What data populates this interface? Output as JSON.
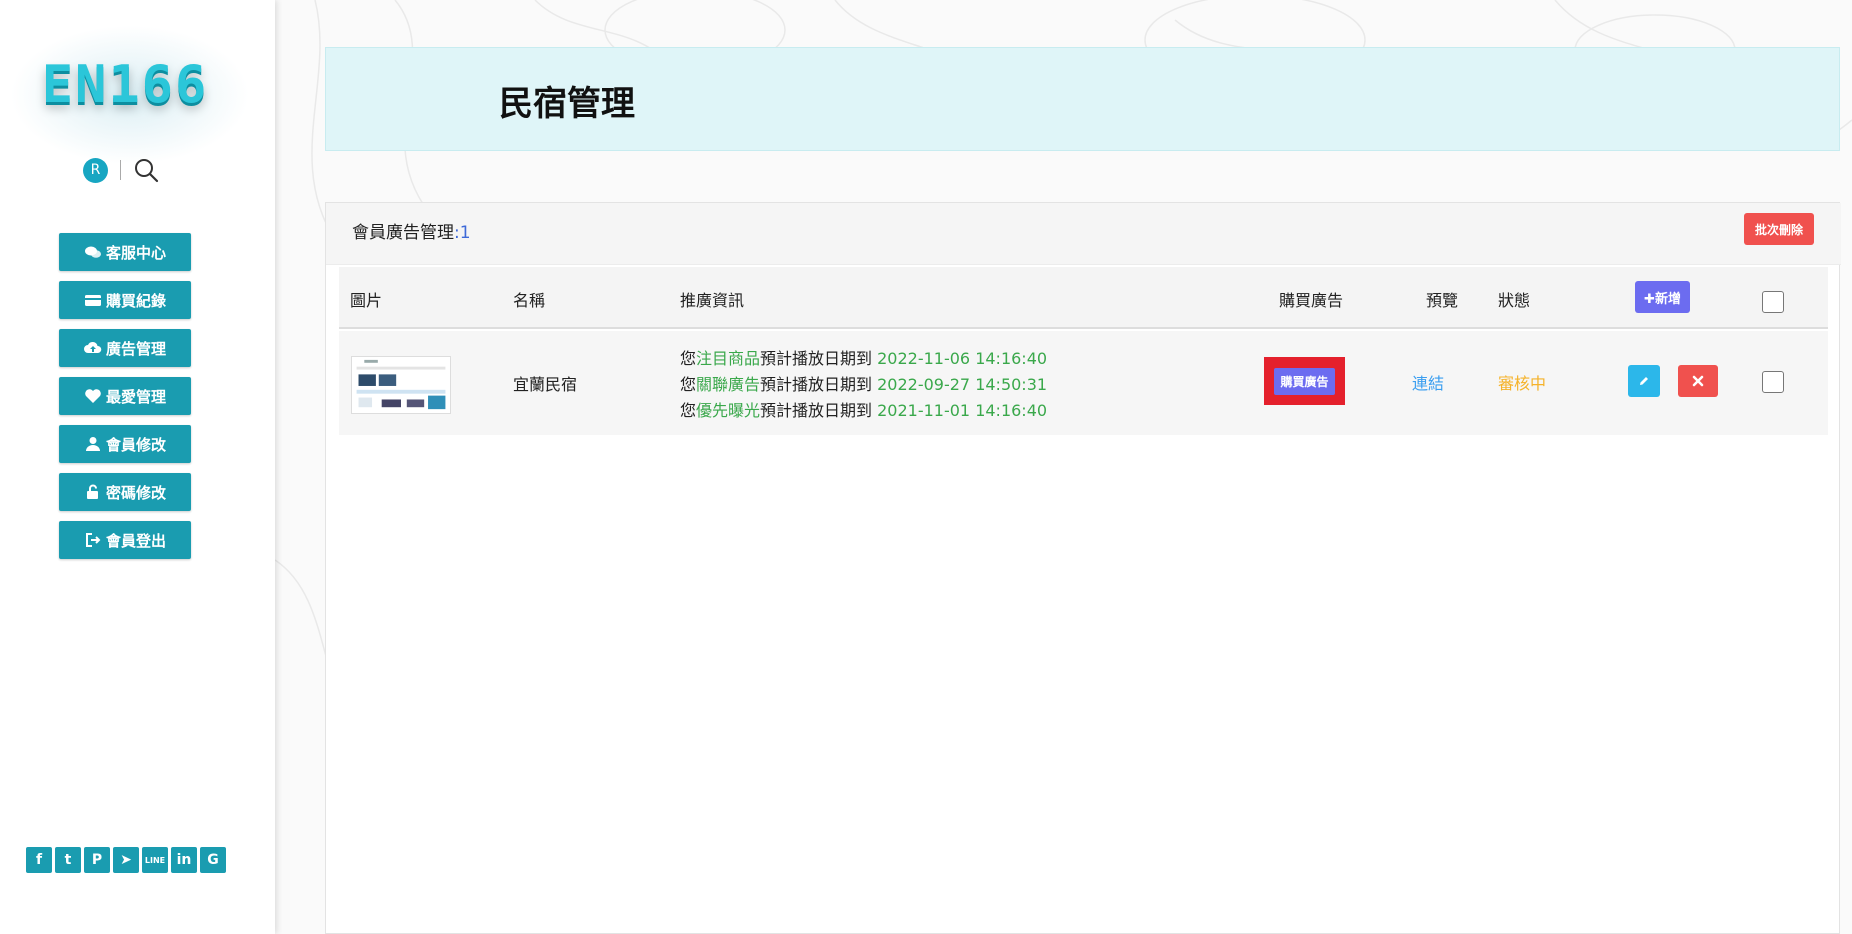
{
  "sidebar": {
    "logo": "EN166",
    "avatar_letter": "R",
    "menu": [
      {
        "label": "客服中心",
        "icon": "comments-icon"
      },
      {
        "label": "購買紀錄",
        "icon": "card-icon"
      },
      {
        "label": "廣告管理",
        "icon": "cloud-upload-icon"
      },
      {
        "label": "最愛管理",
        "icon": "heart-icon"
      },
      {
        "label": "會員修改",
        "icon": "user-icon"
      },
      {
        "label": "密碼修改",
        "icon": "unlock-icon"
      },
      {
        "label": "會員登出",
        "icon": "sign-out-icon"
      }
    ],
    "social": [
      {
        "name": "facebook-icon",
        "glyph": "f"
      },
      {
        "name": "twitter-icon",
        "glyph": "t"
      },
      {
        "name": "pinterest-icon",
        "glyph": "P"
      },
      {
        "name": "telegram-icon",
        "glyph": "➤"
      },
      {
        "name": "line-icon",
        "glyph": "LINE"
      },
      {
        "name": "linkedin-icon",
        "glyph": "in"
      },
      {
        "name": "google-icon",
        "glyph": "G"
      }
    ]
  },
  "header": {
    "title": "民宿管理"
  },
  "panel": {
    "title": "會員廣告管理",
    "count_sep": ":",
    "count": "1",
    "batch_delete_label": "批次刪除"
  },
  "table": {
    "columns": {
      "image": "圖片",
      "name": "名稱",
      "info": "推廣資訊",
      "buy": "購買廣告",
      "preview": "預覽",
      "status": "狀態"
    },
    "add_label": "✚新增",
    "rows": [
      {
        "name": "宜蘭民宿",
        "info": [
          {
            "prefix": "您",
            "highlight": "注目商品",
            "middle": "預計播放日期到 ",
            "date": "2022-11-06 14:16:40"
          },
          {
            "prefix": "您",
            "highlight": "關聯廣告",
            "middle": "預計播放日期到 ",
            "date": "2022-09-27 14:50:31"
          },
          {
            "prefix": "您",
            "highlight": "優先曝光",
            "middle": "預計播放日期到 ",
            "date": "2021-11-01 14:16:40"
          }
        ],
        "buy_label": "購買廣告",
        "preview_label": "連結",
        "status": "審核中"
      }
    ]
  },
  "colors": {
    "accent": "#1a9cb0",
    "header_bg": "#dff5f8",
    "danger": "#f0514e",
    "primary": "#6c6cf0",
    "highlight_text": "#3aa84b",
    "link": "#3a9ef0",
    "pending": "#f5b32b"
  }
}
